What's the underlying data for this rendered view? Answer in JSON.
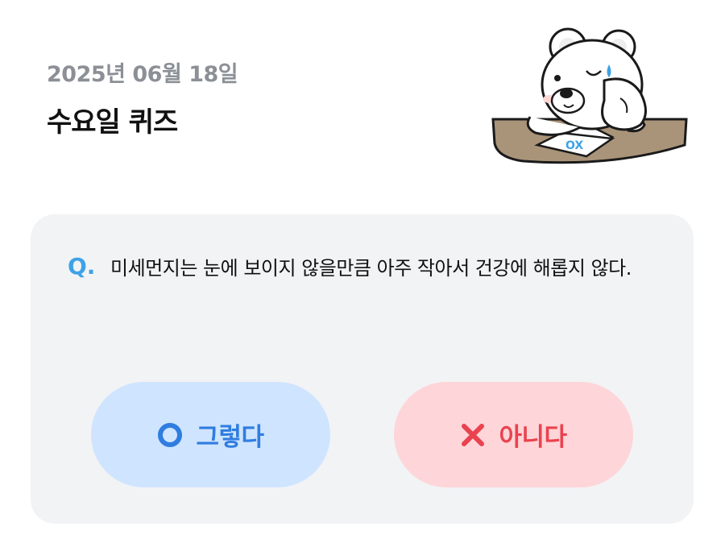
{
  "header": {
    "date": "2025년 06월 18일",
    "title": "수요일 퀴즈"
  },
  "quiz": {
    "q_prefix": "Q.",
    "question": "미세먼지는 눈에 보이지 않을만큼 아주 작아서 건강에 해롭지 않다."
  },
  "answers": {
    "yes_label": "그렇다",
    "no_label": "아니다",
    "yes_icon": "circle-o-icon",
    "no_icon": "x-icon"
  },
  "mascot": {
    "paper_text": "OX"
  },
  "colors": {
    "accent_blue": "#3ea2e6",
    "yes_bg": "#cfe4ff",
    "yes_fg": "#2f7de0",
    "no_bg": "#fed5d8",
    "no_fg": "#e8434f",
    "card_bg": "#f2f3f5"
  }
}
